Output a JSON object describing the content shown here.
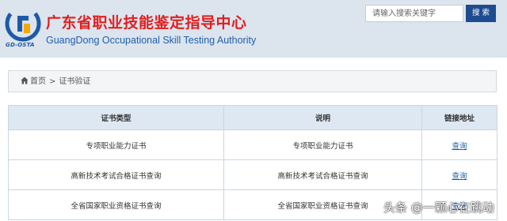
{
  "header": {
    "logo_caption": "GD-OSTA",
    "title": "广东省职业技能鉴定指导中心",
    "subtitle": "GuangDong Occupational Skill Testing Authority"
  },
  "search": {
    "placeholder": "请输入搜索关键字",
    "button_label": "搜 索"
  },
  "breadcrumb": {
    "home": "首页",
    "separator": ">",
    "current": "证书验证"
  },
  "table": {
    "headers": [
      "证书类型",
      "说明",
      "链接地址"
    ],
    "rows": [
      {
        "type": "专项职业能力证书",
        "desc": "专项职业能力证书",
        "link": "查询"
      },
      {
        "type": "高新技术考试合格证书查询",
        "desc": "高新技术考试合格证书查询",
        "link": "查询"
      },
      {
        "type": "全省国家职业资格证书查询",
        "desc": "全省国家职业资格证书查询",
        "link": "查询"
      }
    ]
  },
  "watermark": "头条 @一颗心在跳动",
  "colors": {
    "header_bg": "#dce4ee",
    "title_red": "#e01f1f",
    "subtitle_blue": "#1f5fae",
    "search_button": "#1e4c8f",
    "table_header_bg": "#dde8f3"
  }
}
